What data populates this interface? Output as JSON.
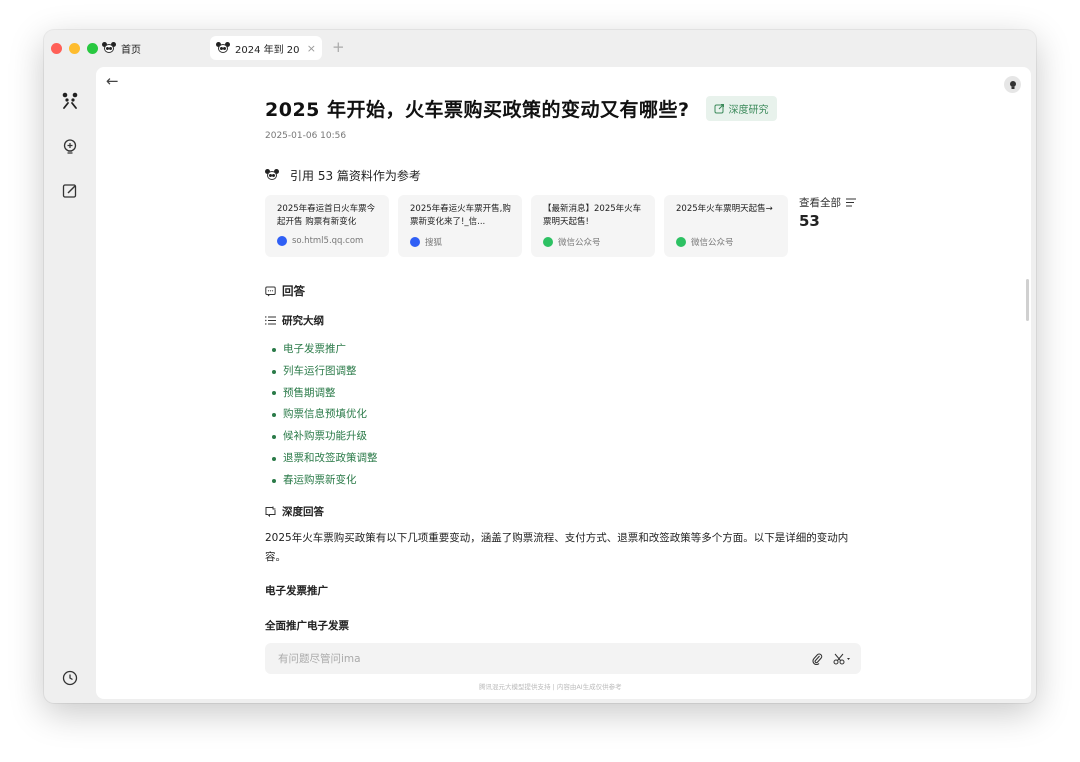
{
  "tabs": [
    {
      "title": "首页"
    },
    {
      "title": "2024 年到 202",
      "close": "×"
    }
  ],
  "new_tab": "+",
  "sidebar": {
    "items": [
      "panda-logo",
      "bulb-add",
      "edit",
      "history"
    ]
  },
  "article": {
    "back": "←",
    "title": "2025 年开始，火车票购买政策的变动又有哪些?",
    "badge": "深度研究",
    "date": "2025-01-06 10:56",
    "refs_heading": "引用 53 篇资料作为参考",
    "refs": [
      {
        "title": "2025年春运首日火车票今起开售 购票有新变化",
        "source": "so.html5.qq.com",
        "source_icon": "browser-blue"
      },
      {
        "title": "2025年春运火车票开售,购票新变化来了!_信...",
        "source": "搜狐",
        "source_icon": "browser-blue"
      },
      {
        "title": "【最新消息】2025年火车票明天起售!",
        "source": "微信公众号",
        "source_icon": "wechat"
      },
      {
        "title": "2025年火车票明天起售→",
        "source": "微信公众号",
        "source_icon": "wechat"
      }
    ],
    "view_all": "查看全部",
    "view_all_count": "53",
    "answer_heading": "回答",
    "outline_heading": "研究大纲",
    "outline": [
      "电子发票推广",
      "列车运行图调整",
      "预售期调整",
      "购票信息预填优化",
      "候补购票功能升级",
      "退票和改签政策调整",
      "春运购票新变化"
    ],
    "deep_answer_heading": "深度回答",
    "intro": "2025年火车票购买政策有以下几项重要变动，涵盖了购票流程、支付方式、退票和改签政策等多个方面。以下是详细的变动内容。",
    "section1": "电子发票推广",
    "section1_sub": "全面推广电子发票"
  },
  "input": {
    "placeholder": "有问题尽管问ima"
  },
  "footer": "腾讯混元大模型提供支持 | 内容由AI生成仅供参考",
  "colors": {
    "accent_green": "#2a7a48",
    "badge_bg": "#e8f2ec"
  }
}
